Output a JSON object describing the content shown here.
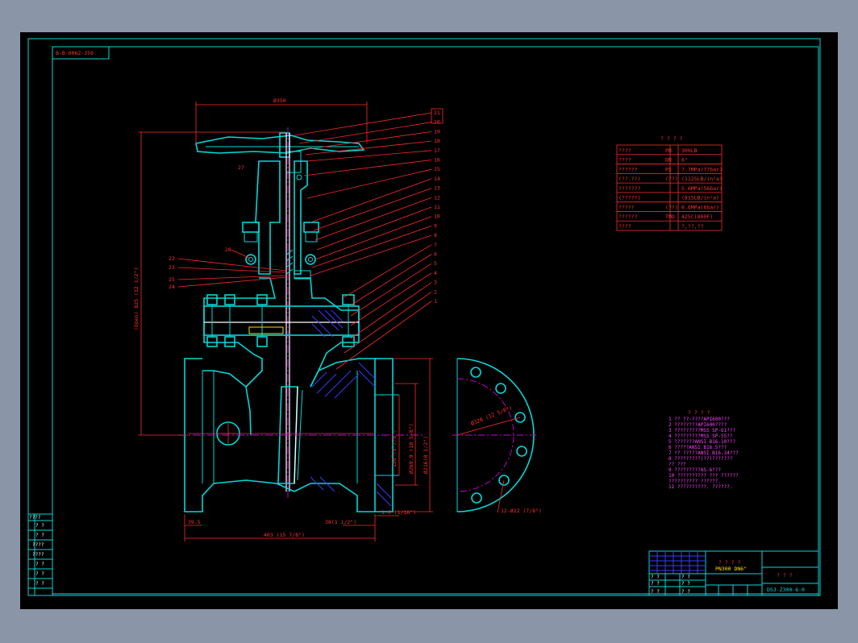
{
  "drawing": {
    "code_box": "B-B-0062-J50",
    "title": "? ? ? ?",
    "title_sub": "PN300 DN6\"",
    "title_block_name": "? ? ?",
    "drawing_no": "DSJ-Z300-6-0"
  },
  "spec_table": {
    "title": "? ? ? ?",
    "rows": [
      {
        "c1": "????",
        "c2": "PN",
        "c3": "300LB"
      },
      {
        "c1": "????",
        "c2": "DN",
        "c3": "6\""
      },
      {
        "c1": "??????",
        "c2": "PS",
        "c3": "7.7MPa(77bar)"
      },
      {
        "c1": "(??.??)",
        "c2": "(??)",
        "c3": "(1125LB/in²a)"
      },
      {
        "c1": "???????",
        "c2": "",
        "c3": "5.6MPa(56bar)"
      },
      {
        "c1": "(?????)",
        "c2": "",
        "c3": "(815LB/in²a)"
      },
      {
        "c1": "?????",
        "c2": "(??)",
        "c3": "0.6MPa(6bar)"
      },
      {
        "c1": "??????",
        "c2": "TMO",
        "c3": "425C(800F)"
      },
      {
        "c1": "????",
        "c2": "",
        "c3": "?,??,??"
      }
    ]
  },
  "notes": {
    "title": "? ? ? ?",
    "lines": [
      "1  ?? ??-????API600???",
      "2  ????????API600????",
      "3  ?????????MSS SP-61???",
      "4  ?????????MSS SP-55??",
      "5  ???????ANSI B16.10???",
      "6  ?????ANSI B16.5???",
      "7  ?? ?????ANSI B16.34???",
      "8  ?????????(??)???????",
      "   ?? ???",
      "9  ?????????AS-6???",
      "10 ?????????? ??? ??????",
      "   ?????????? ??????.",
      "11 ??????????. ??????."
    ]
  },
  "part_numbers": [
    "21",
    "20",
    "19",
    "18",
    "17",
    "16",
    "15",
    "14",
    "13",
    "12",
    "11",
    "10",
    "9",
    "8",
    "7",
    "6",
    "5",
    "4",
    "3",
    "2",
    "1"
  ],
  "left_part_numbers": [
    "22",
    "23",
    "25",
    "24"
  ],
  "dimensions": {
    "handwheel": "Ø350",
    "height_open": "(Open) 825 (32 1/2\")",
    "total_length": "403 (15 7/8\")",
    "flange_thk": "39.5",
    "dim_a": "38(1 1/2\")",
    "dim_b": "1.6 (1/16\")",
    "dim_c": "150 (5 7/8\")",
    "dim_d": "Ø269.9 (10 5/8\")",
    "dim_e": "Ø216(8 1/2\")",
    "dim_f": "Ø320 (12 5/8\")",
    "bolt_holes": "12-Ø22 (7/8\")",
    "raised_face": "39.5",
    "label_27": "27",
    "label_28": "28"
  },
  "left_strip": [
    "????",
    "? ?",
    "? ?",
    "????",
    "????",
    "? ?",
    "? ?",
    "? ?"
  ],
  "title_block_small": [
    "? ?",
    "? ?",
    "? ?",
    "? ?",
    "? ?",
    "? ?"
  ]
}
